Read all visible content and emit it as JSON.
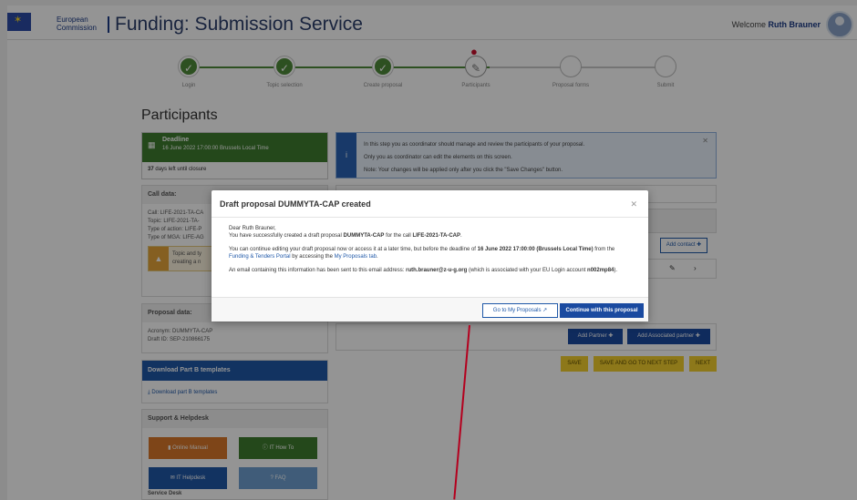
{
  "header": {
    "ec_logo_line1": "European",
    "ec_logo_line2": "Commission",
    "app_title": "Funding: Submission Service",
    "welcome_prefix": "Welcome",
    "user_name": "Ruth Brauner"
  },
  "stepper": {
    "steps": [
      {
        "label": "Login",
        "state": "done"
      },
      {
        "label": "Topic selection",
        "state": "done"
      },
      {
        "label": "Create proposal",
        "state": "done"
      },
      {
        "label": "Participants",
        "state": "current"
      },
      {
        "label": "Proposal forms",
        "state": "todo"
      },
      {
        "label": "Submit",
        "state": "todo"
      }
    ]
  },
  "page_title": "Participants",
  "deadline": {
    "title": "Deadline",
    "date": "16 June 2022 17:00:00 Brussels Local Time",
    "days_count": "37",
    "days_text": "days left until closure"
  },
  "info_box": {
    "line1": "In this step you as coordinator should manage and review the participants of your proposal.",
    "line2": "Only you as coordinator can edit the elements on this screen.",
    "line3": "Note: Your changes will be applied only after you click the \"Save Changes\" button."
  },
  "call_data": {
    "header": "Call data:",
    "call": "Call: LIFE-2021-TA-CA",
    "topic": "Topic: LIFE-2021-TA-",
    "action": "Type of action: LIFE-P",
    "mga": "Type of MGA: LIFE-AG",
    "warn_line1": "Topic and ty",
    "warn_line2": "creating a n"
  },
  "proposal_data": {
    "header": "Proposal data:",
    "acronym": "Acronym: DUMMYTA-CAP",
    "draft_id": "Draft ID: SEP-210866175"
  },
  "download": {
    "header": "Download Part B templates",
    "link": "Download part B templates"
  },
  "support": {
    "header": "Support & Helpdesk",
    "online_manual": "Online Manual",
    "it_how_to": "IT How To",
    "it_helpdesk": "IT Helpdesk",
    "faq": "FAQ",
    "service_desk": "Service Desk"
  },
  "buttons": {
    "add_contact": "Add contact",
    "add_partner": "Add Partner",
    "add_associated": "Add Associated partner",
    "save": "SAVE",
    "save_next": "SAVE AND GO TO NEXT STEP",
    "next": "NEXT"
  },
  "modal": {
    "title": "Draft proposal DUMMYTA-CAP created",
    "greeting": "Dear Ruth Brauner,",
    "p1_a": "You have successfully created a draft proposal ",
    "p1_acronym": "DUMMYTA-CAP",
    "p1_b": " for the call ",
    "p1_call": "LIFE-2021-TA-CAP",
    "p1_c": ".",
    "p2_a": "You can continue editing your draft proposal now or access it at a later time, but before the deadline of ",
    "p2_deadline": "16 June 2022 17:00:00 (Brussels Local Time)",
    "p2_b": " from the ",
    "p2_link1": "Funding & Tenders Portal",
    "p2_c": " by accessing the ",
    "p2_link2": "My Proposals tab",
    "p2_d": ".",
    "p3_a": "An email containing this information has been sent to this email address: ",
    "p3_email": "ruth.brauner@z-u-g.org",
    "p3_b": " (which is associated with your EU Login account ",
    "p3_account": "n002mp84",
    "p3_c": ").",
    "btn_my_proposals": "Go to My Proposals",
    "btn_continue": "Continue with this proposal"
  },
  "colors": {
    "ec_blue": "#1a4aa0",
    "step_green": "#4f8a3a",
    "save_yellow": "#f3cf2e",
    "annotation_red": "#b4001e"
  }
}
